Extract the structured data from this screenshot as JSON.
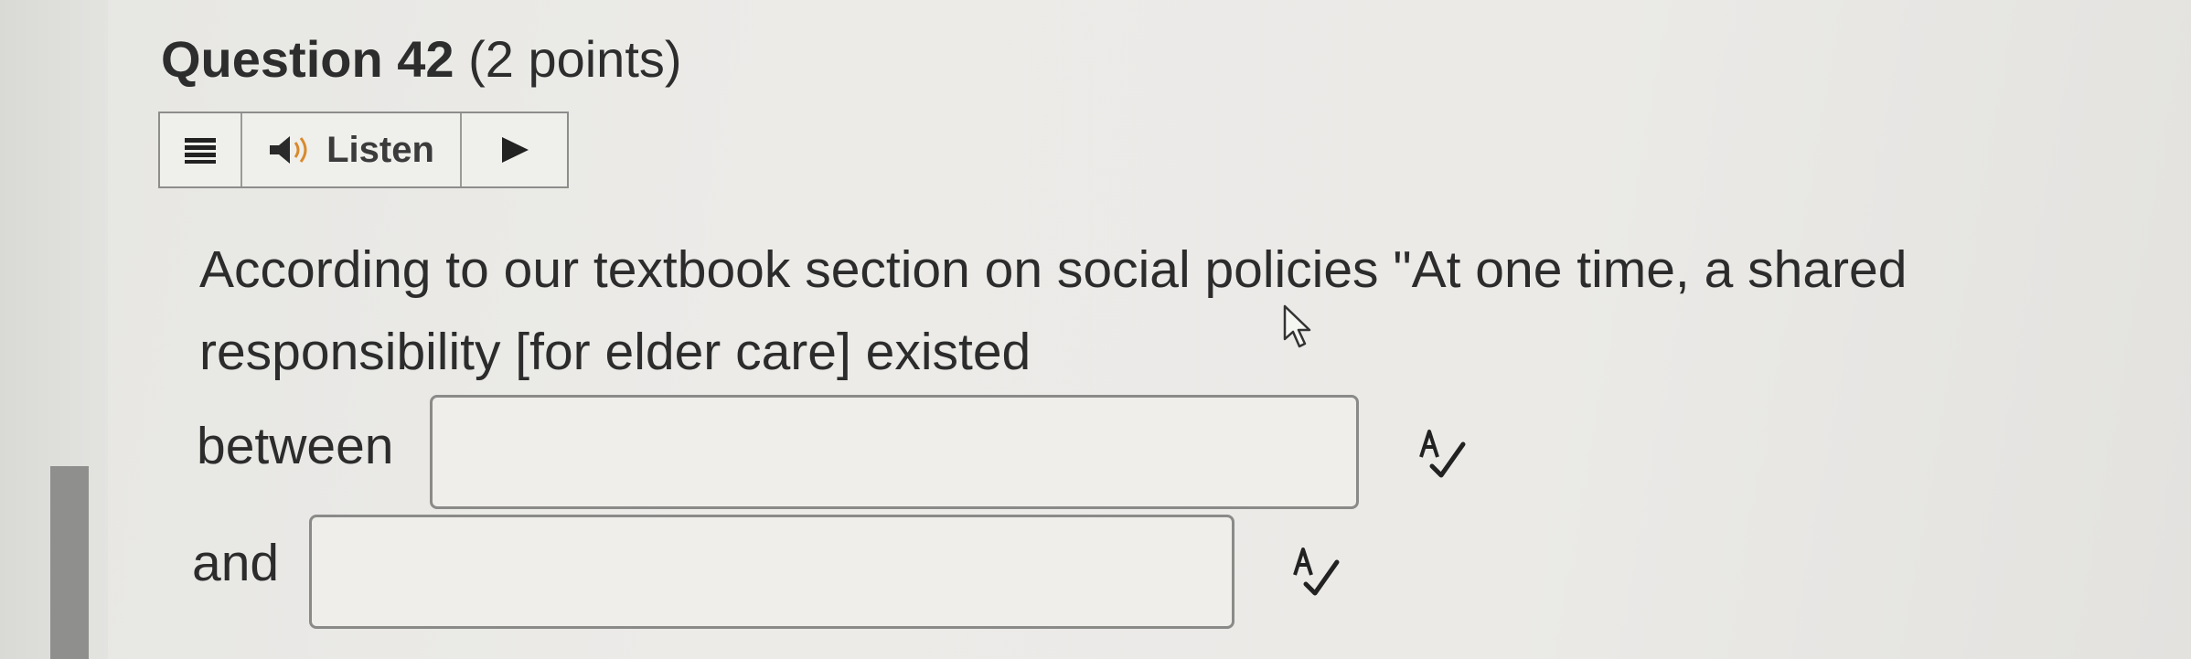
{
  "question": {
    "number_label": "Question 42",
    "points_label": "(2 points)"
  },
  "listen_toolbar": {
    "menu_icon": "menu-icon",
    "speaker_icon": "speaker-icon",
    "listen_label": "Listen",
    "play_icon": "play-icon"
  },
  "prompt": {
    "text": "According to our textbook section on social policies \"At one time, a shared responsibility [for elder care] existed"
  },
  "blanks": [
    {
      "label": "between",
      "value": "",
      "spellcheck_icon": "spellcheck-icon"
    },
    {
      "label": "and",
      "value": "",
      "spellcheck_icon": "spellcheck-icon"
    }
  ],
  "colors": {
    "background": "#ebeae7",
    "text": "#2c2c2c",
    "border": "#8a8a88"
  }
}
